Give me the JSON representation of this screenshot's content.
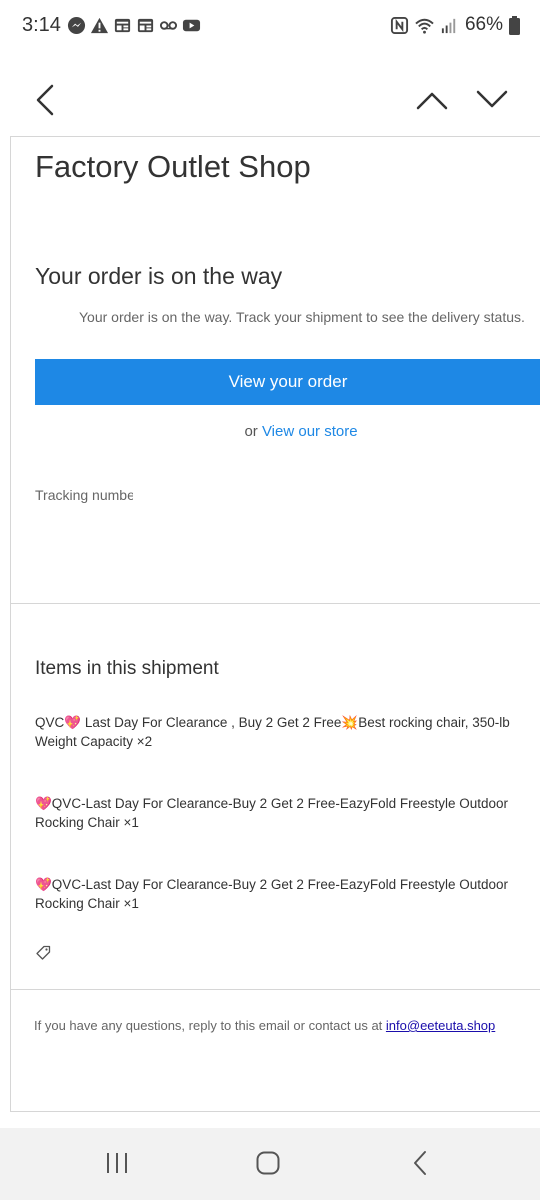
{
  "status_bar": {
    "time": "3:14",
    "battery": "66%",
    "left_icons": [
      "messenger-icon",
      "warning-icon",
      "news-icon",
      "news-icon",
      "voicemail-icon",
      "youtube-icon"
    ],
    "right_icons": [
      "nfc-icon",
      "wifi-icon",
      "signal-icon",
      "battery-icon"
    ]
  },
  "nav": {
    "back_icon": "chevron-left-icon",
    "prev_icon": "chevron-up-icon",
    "next_icon": "chevron-down-icon"
  },
  "email": {
    "shop_name": "Factory Outlet Shop",
    "heading": "Your order is on the way",
    "subtext": "Your order is on the way. Track your shipment to see the delivery status.",
    "view_order_label": "View your order",
    "or_text": "or ",
    "view_store_label": "View our store",
    "tracking_label": "Tracking number",
    "items_heading": "Items in this shipment",
    "items": [
      "QVC💖 Last Day For Clearance , Buy 2 Get 2 Free💥Best rocking chair, 350-lb Weight Capacity ×2",
      "💖QVC-Last Day For Clearance-Buy 2 Get 2 Free-EazyFold Freestyle Outdoor Rocking Chair ×1",
      "💖QVC-Last Day For Clearance-Buy 2 Get 2 Free-EazyFold Freestyle Outdoor Rocking Chair ×1"
    ],
    "footer_text": "If you have any questions, reply to this email or contact us at ",
    "footer_email": "info@eeteuta.shop"
  },
  "colors": {
    "accent": "#1e88e5",
    "link_email": "#1a0dab"
  }
}
